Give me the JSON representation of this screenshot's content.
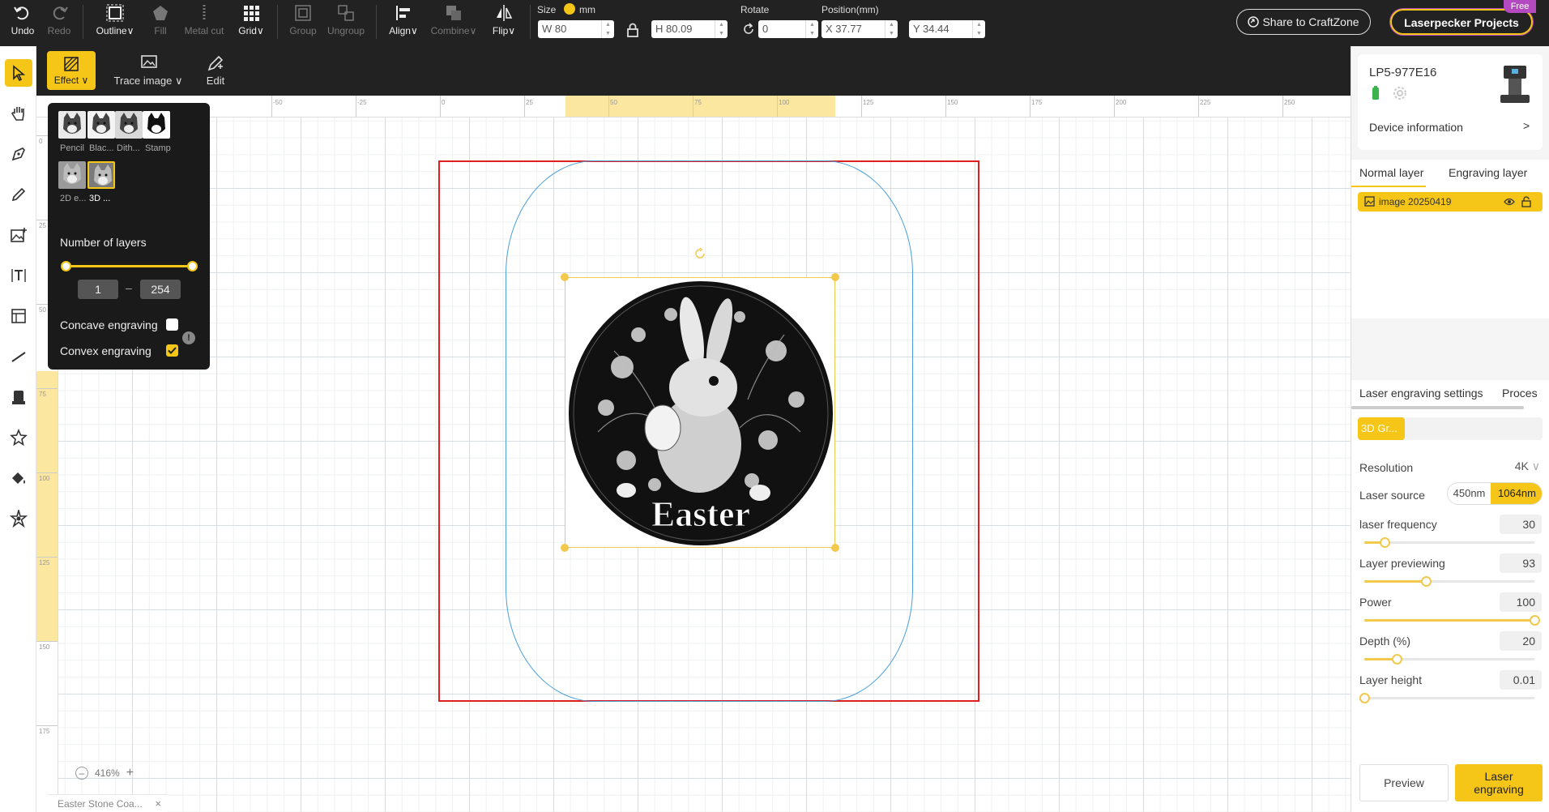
{
  "toolbar": {
    "undo": "Undo",
    "redo": "Redo",
    "outline": "Outline",
    "fill": "Fill",
    "metal_cut": "Metal cut",
    "grid": "Grid",
    "group": "Group",
    "ungroup": "Ungroup",
    "align": "Align",
    "combine": "Combine",
    "flip": "Flip",
    "size_label": "Size",
    "unit": "mm",
    "width": "W 80",
    "height": "H 80.09",
    "rotate_label": "Rotate",
    "rotate": "0",
    "position_label": "Position(mm)",
    "pos_x": "X 37.77",
    "pos_y": "Y 34.44",
    "share": "Share to CraftZone",
    "projects": "Laserpecker Projects",
    "free_badge": "Free",
    "caret": "∨"
  },
  "subtoolbar": {
    "effect": "Effect",
    "trace_image": "Trace image",
    "edit": "Edit"
  },
  "effect_panel": {
    "thumbs": [
      "Pencil",
      "Blac...",
      "Dith...",
      "Stamp",
      "2D e...",
      "3D ..."
    ],
    "layers_label": "Number of layers",
    "layers_min": "1",
    "layers_max": "254",
    "dash": "–",
    "layer_range_fraction": [
      0,
      1
    ],
    "concave_label": "Concave engraving",
    "concave_checked": false,
    "convex_label": "Convex engraving",
    "convex_checked": true,
    "info": "!"
  },
  "canvas": {
    "ruler_top": [
      "-50",
      "-25",
      "0",
      "25",
      "50",
      "75",
      "100",
      "125",
      "150",
      "175",
      "200",
      "225",
      "250"
    ],
    "ruler_left": [
      "0",
      "25",
      "50",
      "75",
      "100",
      "125",
      "150",
      "175"
    ],
    "image_text": "Easter",
    "zoom": "416%",
    "zoom_out": "–",
    "zoom_in": "+",
    "file_tab": "Easter Stone Coa...",
    "close": "×"
  },
  "right": {
    "device_name": "LP5-977E16",
    "device_info": "Device information",
    "chevron": ">",
    "tab_normal": "Normal layer",
    "tab_engraving": "Engraving layer",
    "layer_item": "image 20250419",
    "settings_tab": "Laser engraving settings",
    "process_tab": "Proces",
    "mode": "3D Gr...",
    "resolution_label": "Resolution",
    "resolution": "4K",
    "laser_source_label": "Laser source",
    "source_a": "450nm",
    "source_b": "1064nm",
    "sliders": [
      {
        "label": "laser frequency",
        "value": "30",
        "fraction": 0.12
      },
      {
        "label": "Layer previewing",
        "value": "93",
        "fraction": 0.36
      },
      {
        "label": "Power",
        "value": "100",
        "fraction": 1.0
      },
      {
        "label": "Depth (%)",
        "value": "20",
        "fraction": 0.19
      },
      {
        "label": "Layer height",
        "value": "0.01",
        "fraction": 0.0
      }
    ],
    "preview": "Preview",
    "laser_engraving": "Laser engraving"
  },
  "colors": {
    "accent": "#f5c518",
    "toolbar_bg": "#222222",
    "selection": "#f2c94c",
    "work_area": "#e02020",
    "outline": "#4a9fd8"
  }
}
